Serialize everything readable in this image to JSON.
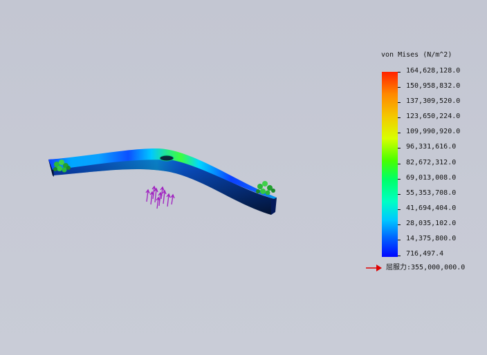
{
  "legend": {
    "title": "von Mises (N/m^2)",
    "labels": [
      "164,628,128.0",
      "150,958,832.0",
      "137,309,520.0",
      "123,650,224.0",
      "109,990,920.0",
      "96,331,616.0",
      "82,672,312.0",
      "69,013,008.0",
      "55,353,708.0",
      "41,694,404.0",
      "28,035,102.0",
      "14,375,800.0",
      "716,497.4"
    ],
    "colors": [
      "#ff2200",
      "#f4c800",
      "#48ff00",
      "#00ffc4",
      "#0006ff"
    ]
  },
  "yield_strength": {
    "label": "屈服力:355,000,000.0",
    "arrow_color": "#e00000"
  }
}
